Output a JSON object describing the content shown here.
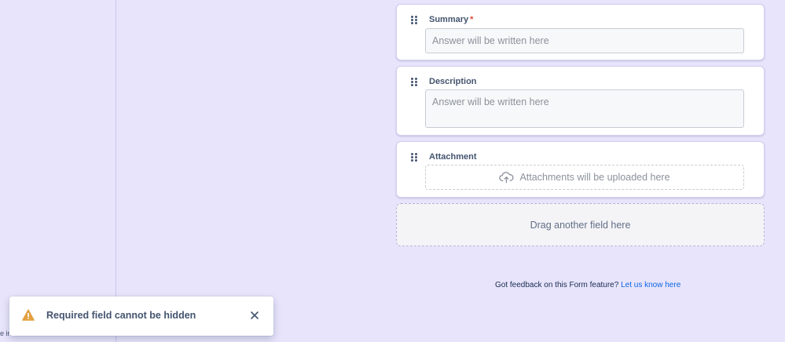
{
  "form": {
    "fields": [
      {
        "label": "Summary",
        "required_marker": "*",
        "placeholder": "Answer will be written here"
      },
      {
        "label": "Description",
        "placeholder": "Answer will be written here"
      },
      {
        "label": "Attachment",
        "placeholder": "Attachments will be uploaded here"
      }
    ],
    "drop_zone_label": "Drag another field here"
  },
  "feedback": {
    "text": "Got feedback on this Form feature?",
    "link_label": "Let us know here"
  },
  "toast": {
    "message": "Required field cannot be hidden",
    "icon": "warning-icon",
    "close_icon": "close-icon"
  },
  "left_panel": {
    "clipped_text": "e in"
  },
  "colors": {
    "background": "#e8e4fc",
    "required": "#e34935",
    "link": "#0c66e4",
    "warning": "#e2a03f"
  }
}
